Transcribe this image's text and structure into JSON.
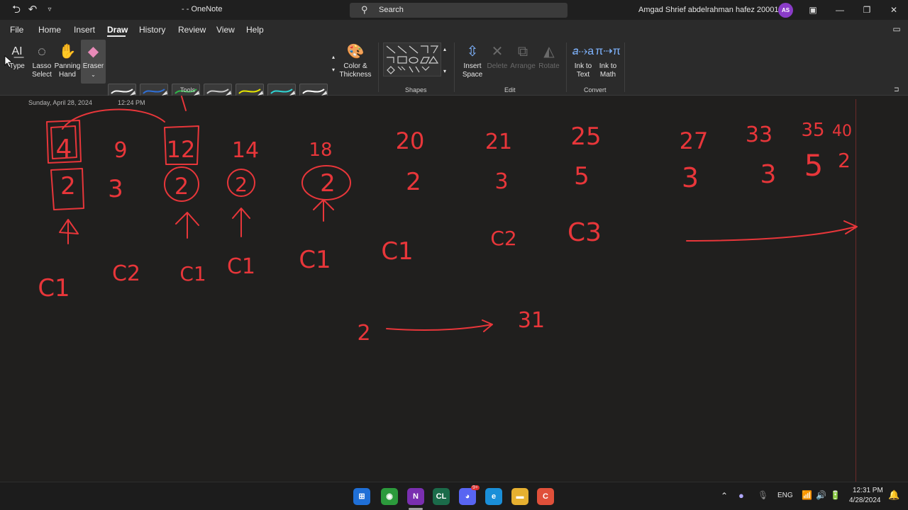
{
  "titlebar": {
    "app_title": "- - OneNote",
    "search_label": "Search",
    "user_name": "Amgad Shrief abdelrahman hafez 2000121",
    "avatar_initials": "AS"
  },
  "menu": {
    "items": [
      "File",
      "Home",
      "Insert",
      "Draw",
      "History",
      "Review",
      "View",
      "Help"
    ],
    "active": "Draw"
  },
  "ribbon": {
    "tools": {
      "type": "Type",
      "lasso_line1": "Lasso",
      "lasso_line2": "Select",
      "panning_line1": "Panning",
      "panning_line2": "Hand",
      "eraser": "Eraser",
      "color_line1": "Color &",
      "color_line2": "Thickness",
      "group_label": "Tools"
    },
    "pens_top": [
      "#f2f2f2",
      "#2f6fd6",
      "#2fb84a",
      "#c8c8c8",
      "#e6e600",
      "#2fd4d4",
      "#ffffff"
    ],
    "pens_bottom": [
      "#e03030",
      "#2f6fd6",
      "#2fb84a",
      "#c8c8c8",
      "#bbbbbb",
      "#d43cd4",
      "#ffffff"
    ],
    "shapes_label": "Shapes",
    "edit": {
      "insert_line1": "Insert",
      "insert_line2": "Space",
      "delete": "Delete",
      "arrange": "Arrange",
      "rotate": "Rotate",
      "group_label": "Edit"
    },
    "convert": {
      "ink_text_line1": "Ink to",
      "ink_text_line2": "Text",
      "ink_math_line1": "Ink to",
      "ink_math_line2": "Math",
      "group_label": "Convert"
    }
  },
  "page": {
    "date": "Sunday, April 28, 2024",
    "time": "12:24 PM",
    "ink_color": "#e8363a",
    "top_row": [
      "4",
      "9",
      "12",
      "14",
      "18",
      "20",
      "21",
      "25",
      "27",
      "33",
      "35",
      "40"
    ],
    "second_row": [
      "2",
      "3",
      "2",
      "2",
      "2",
      "2",
      "3",
      "5",
      "3",
      "3",
      "5",
      "2"
    ],
    "labels": [
      "C1",
      "C2",
      "C1",
      "C1",
      "C1",
      "C1",
      "C2",
      "C3"
    ],
    "equation_left": "2",
    "equation_right": "31"
  },
  "taskbar": {
    "apps": [
      "Start",
      "Chrome",
      "OneNote",
      "CLion",
      "Discord",
      "Edge",
      "File Explorer",
      "Code"
    ],
    "lang": "ENG",
    "time": "12:31 PM",
    "date": "4/28/2024",
    "discord_badge": "9+"
  }
}
